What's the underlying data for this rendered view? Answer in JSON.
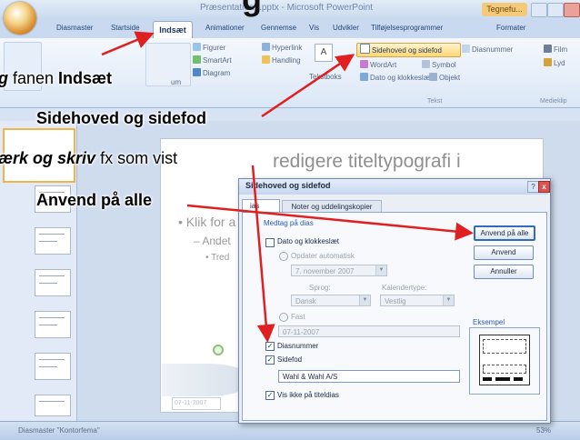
{
  "heading": "g",
  "app": {
    "doc_title": "Præsentation1.pptx - Microsoft PowerPoint",
    "context_tab": "Tegnefu..."
  },
  "tabs": [
    "Diasmaster",
    "Startside",
    "Indsæt",
    "Animationer",
    "Gennemse",
    "Vis",
    "Udvikler",
    "Tilføjelsesprogrammer",
    "Formater"
  ],
  "ribbon": {
    "figurer": "Figurer",
    "smartart": "SmartArt",
    "diagram": "Diagram",
    "hyperlink": "Hyperlink",
    "handling": "Handling",
    "tekstboks": "Tekstboks",
    "sidehoved": "Sidehoved og sidefod",
    "diasnummer": "Diasnummer",
    "wordart": "WordArt",
    "symbol": "Symbol",
    "dato": "Dato og klokkeslæt",
    "objekt": "Objekt",
    "film": "Film",
    "lyd": "Lyd",
    "um": "um",
    "group_tekst": "Tekst",
    "group_medieklip": "Medieklip"
  },
  "slide": {
    "title_placeholder": "redigere titeltypografi i",
    "bullet1": "• Klik for a",
    "bullet2": "– Andet",
    "bullet3": "• Tred",
    "date": "07-11-2007"
  },
  "statusbar": {
    "left": "Diasmaster   \"Kontorfema\"",
    "zoom": "53%"
  },
  "dialog": {
    "title": "Sidehoved og sidefod",
    "tab_dias": "ias",
    "tab_noter": "Noter og uddelingskopier",
    "section_label": "Medtag på dias",
    "dato_label": "Dato og klokkeslæt",
    "opdater_label": "Opdater automatisk",
    "opdater_value": "7. november 2007",
    "sprog_label": "Sprog:",
    "sprog_value": "Dansk",
    "kalender_label": "Kalendertype:",
    "kalender_value": "Vestlig",
    "fast_label": "Fast",
    "fast_value": "07-11-2007",
    "diasnummer_label": "Diasnummer",
    "sidefod_label": "Sidefod",
    "sidefod_value": "Wahl & Wahl A/S",
    "vis_ikke_label": "Vis ikke på titeldias",
    "btn_anvend_alle": "Anvend på alle",
    "btn_anvend": "Anvend",
    "btn_annuller": "Annuller",
    "eksempel_label": "Eksempel",
    "help": "?",
    "close": "x",
    "check": "✓"
  },
  "annotations": {
    "line1_pre": "g",
    "line1_mid": " fanen ",
    "line1_bold": "Indsæt",
    "line2": "Sidehoved og sidefod",
    "line3_bold": "ærk og skriv",
    "line3_rest": " fx som vist",
    "line4": "Anvend på alle"
  },
  "colors": {
    "arrow": "#e02020",
    "ribbon_blue": "#c9daf0"
  }
}
